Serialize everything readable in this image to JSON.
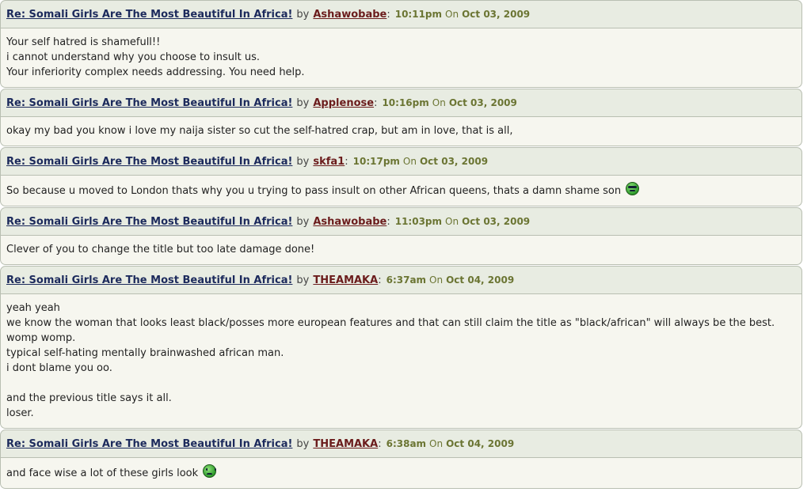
{
  "colors": {
    "header_bg": "#e8ece2",
    "body_bg": "#f6f6ef",
    "title_link": "#1c2a5c",
    "username": "#6b1c1c",
    "timestamp": "#6b7533"
  },
  "posts": [
    {
      "title": "Re: Somali Girls Are The Most Beautiful In Africa!",
      "by": "by",
      "user": "Ashawobabe",
      "time": "10:11pm",
      "on": "On",
      "date": "Oct 03, 2009",
      "lines": [
        "Your self hatred is shamefull!!",
        "i cannot understand why you choose to insult us.",
        "Your inferiority complex needs addressing. You need help."
      ]
    },
    {
      "title": "Re: Somali Girls Are The Most Beautiful In Africa!",
      "by": "by",
      "user": "Applenose",
      "time": "10:16pm",
      "on": "On",
      "date": "Oct 03, 2009",
      "lines": [
        "okay my bad you know i love my naija sister so cut the self-hatred crap, but am in love, that is all,"
      ]
    },
    {
      "title": "Re: Somali Girls Are The Most Beautiful In Africa!",
      "by": "by",
      "user": "skfa1",
      "time": "10:17pm",
      "on": "On",
      "date": "Oct 03, 2009",
      "lines": [
        "So because u moved to London thats why you u trying to pass insult on other African queens, thats a damn shame son"
      ],
      "smiley": "cool-smiley-icon"
    },
    {
      "title": "Re: Somali Girls Are The Most Beautiful In Africa!",
      "by": "by",
      "user": "Ashawobabe",
      "time": "11:03pm",
      "on": "On",
      "date": "Oct 03, 2009",
      "lines": [
        "Clever of you to change the title but too late damage done!"
      ]
    },
    {
      "title": "Re: Somali Girls Are The Most Beautiful In Africa!",
      "by": "by",
      "user": "THEAMAKA",
      "time": "6:37am",
      "on": "On",
      "date": "Oct 04, 2009",
      "lines": [
        "yeah yeah",
        "we know the woman that looks least black/posses more european features and that can still claim the title as \"black/african\" will always be the best.",
        "womp womp.",
        "typical self-hating mentally brainwashed african man.",
        "i dont blame you oo.",
        "",
        "and the previous title says it all.",
        "loser."
      ]
    },
    {
      "title": "Re: Somali Girls Are The Most Beautiful In Africa!",
      "by": "by",
      "user": "THEAMAKA",
      "time": "6:38am",
      "on": "On",
      "date": "Oct 04, 2009",
      "lines": [
        "and face wise a lot of these girls look"
      ],
      "smiley": "sick-smiley-icon"
    }
  ]
}
